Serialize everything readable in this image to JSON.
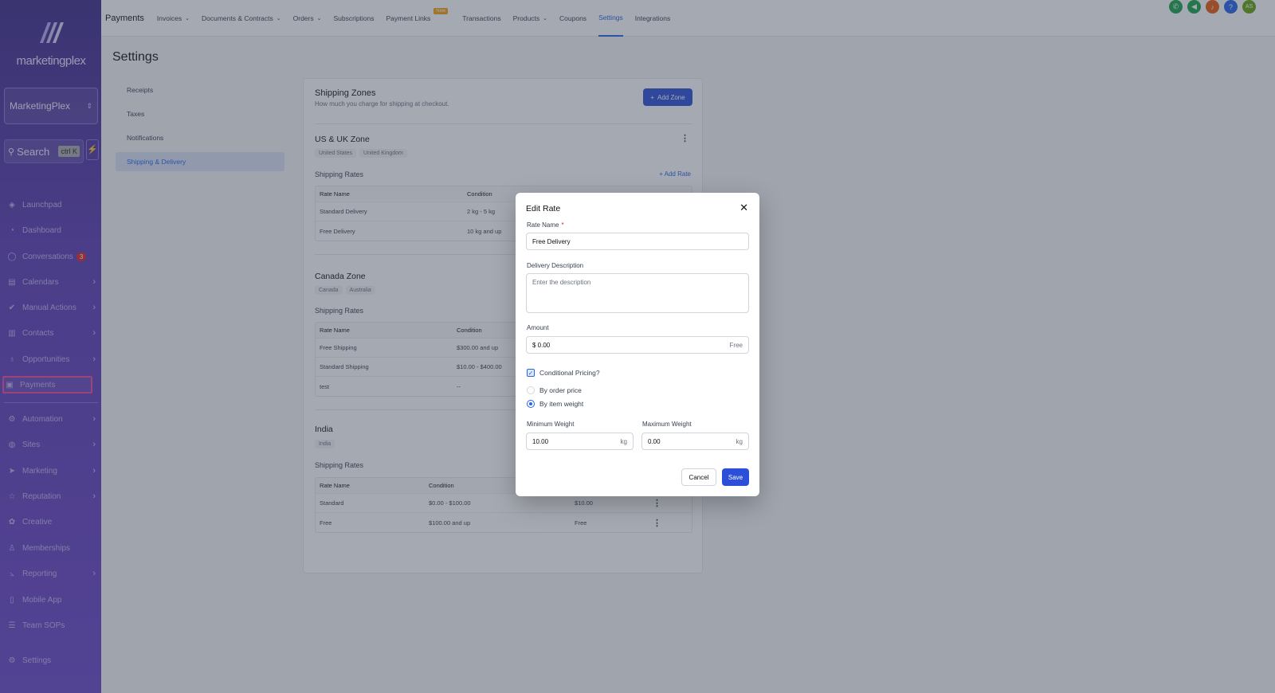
{
  "brand": {
    "logo_text": "marketingplex"
  },
  "sidebar": {
    "account": "MarketingPlex",
    "search_label": "Search",
    "search_shortcut": "ctrl K",
    "items": [
      {
        "label": "Launchpad",
        "icon": "rocket-icon"
      },
      {
        "label": "Dashboard",
        "icon": "dashboard-icon"
      },
      {
        "label": "Conversations",
        "icon": "chat-icon",
        "badge": "3"
      },
      {
        "label": "Calendars",
        "icon": "calendar-icon"
      },
      {
        "label": "Manual Actions",
        "icon": "check-icon"
      },
      {
        "label": "Contacts",
        "icon": "contacts-icon"
      },
      {
        "label": "Opportunities",
        "icon": "funnel-icon"
      },
      {
        "label": "Payments",
        "icon": "payments-icon"
      },
      {
        "label": "Automation",
        "icon": "automation-icon"
      },
      {
        "label": "Sites",
        "icon": "globe-icon"
      },
      {
        "label": "Marketing",
        "icon": "send-icon"
      },
      {
        "label": "Reputation",
        "icon": "star-icon"
      },
      {
        "label": "Creative",
        "icon": "palette-icon"
      },
      {
        "label": "Memberships",
        "icon": "award-icon"
      },
      {
        "label": "Reporting",
        "icon": "chart-icon"
      },
      {
        "label": "Mobile App",
        "icon": "phone-icon"
      },
      {
        "label": "Team SOPs",
        "icon": "list-icon"
      },
      {
        "label": "Settings",
        "icon": "gear-icon"
      }
    ]
  },
  "topbar": {
    "app_title": "Payments",
    "tabs": [
      {
        "label": "Invoices"
      },
      {
        "label": "Documents & Contracts"
      },
      {
        "label": "Orders"
      },
      {
        "label": "Subscriptions"
      },
      {
        "label": "Payment Links",
        "badge": "New"
      },
      {
        "label": "Transactions"
      },
      {
        "label": "Products"
      },
      {
        "label": "Coupons"
      },
      {
        "label": "Settings"
      },
      {
        "label": "Integrations"
      }
    ],
    "user_initials": "AS",
    "colors": {
      "phone": "#16a34a",
      "megaphone": "#16a34a",
      "bell": "#ea580c",
      "help": "#2563eb",
      "avatar": "#65a30d"
    }
  },
  "page": {
    "title": "Settings",
    "settings_nav": [
      "Receipts",
      "Taxes",
      "Notifications",
      "Shipping & Delivery"
    ]
  },
  "shipping": {
    "title": "Shipping Zones",
    "subtitle": "How much you charge for shipping at checkout.",
    "add_zone": "Add Zone",
    "shipping_rates_label": "Shipping Rates",
    "add_rate": "Add Rate",
    "columns": [
      "Rate Name",
      "Condition"
    ],
    "zones": [
      {
        "name": "US & UK Zone",
        "countries": [
          "United States",
          "United Kingdom"
        ],
        "rates": [
          {
            "name": "Standard Delivery",
            "condition": "2 kg - 5 kg"
          },
          {
            "name": "Free Delivery",
            "condition": "10 kg and up"
          }
        ]
      },
      {
        "name": "Canada Zone",
        "countries": [
          "Canada",
          "Australia"
        ],
        "rates": [
          {
            "name": "Free Shipping",
            "condition": "$300.00 and up"
          },
          {
            "name": "Standard Shipping",
            "condition": "$10.00 - $400.00"
          },
          {
            "name": "test",
            "condition": "--"
          }
        ]
      },
      {
        "name": "India",
        "countries": [
          "India"
        ],
        "rates": [
          {
            "name": "Standard",
            "condition": "$0.00 - $100.00",
            "price": "$10.00"
          },
          {
            "name": "Free",
            "condition": "$100.00 and up",
            "price": "Free"
          }
        ]
      }
    ]
  },
  "modal": {
    "title": "Edit Rate",
    "rate_name_label": "Rate Name",
    "rate_name_value": "Free Delivery",
    "delivery_desc_label": "Delivery Description",
    "delivery_desc_placeholder": "Enter the description",
    "amount_label": "Amount",
    "amount_value": "$ 0.00",
    "amount_suffix": "Free",
    "conditional_label": "Conditional Pricing?",
    "by_order_price": "By order price",
    "by_item_weight": "By item weight",
    "min_weight_label": "Minimum Weight",
    "min_weight_value": "10.00",
    "max_weight_label": "Maximum Weight",
    "max_weight_value": "0.00",
    "unit": "kg",
    "cancel": "Cancel",
    "save": "Save"
  }
}
